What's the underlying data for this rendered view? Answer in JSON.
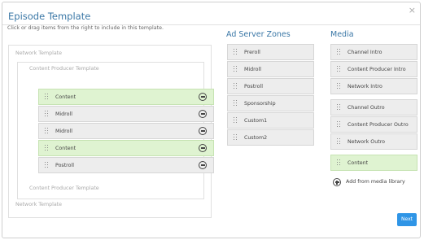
{
  "dialog": {
    "title": "Episode Template",
    "close_label": "×",
    "instructions": "Click or drag items from the right to include in this template."
  },
  "template": {
    "outer_top_label": "Network Template",
    "inner_top_label": "Content Producer Template",
    "inner_bottom_label": "Content Producer Template",
    "outer_bottom_label": "Network Template",
    "items": [
      {
        "label": "Content",
        "color": "#dff3d1"
      },
      {
        "label": "Midroll",
        "color": "#ededed"
      },
      {
        "label": "Midroll",
        "color": "#ededed"
      },
      {
        "label": "Content",
        "color": "#dff3d1"
      },
      {
        "label": "Postroll",
        "color": "#ededed"
      }
    ]
  },
  "ad_server_zones": {
    "heading": "Ad Server Zones",
    "items": [
      "Preroll",
      "Midroll",
      "Postroll",
      "Sponsorship",
      "Custom1",
      "Custom2"
    ]
  },
  "media": {
    "heading": "Media",
    "items": [
      "Channel Intro",
      "Content Producer Intro",
      "Network Intro",
      "Channel Outro",
      "Content Producer Outro",
      "Network Outro",
      "Content"
    ],
    "add_label": "Add from media library"
  },
  "footer": {
    "next_label": "Next"
  },
  "colors": {
    "accent": "#2f95e6",
    "heading": "#3a77a6",
    "content_green": "#dff3d1",
    "row_grey": "#ededed"
  }
}
